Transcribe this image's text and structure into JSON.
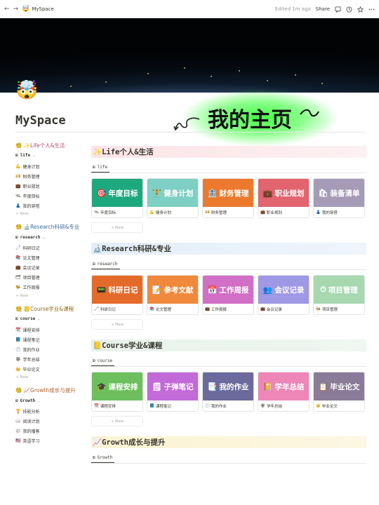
{
  "topbar": {
    "back": "←",
    "forward": "→",
    "page_icon": "🤯",
    "page_name": "MySpace",
    "edited": "Edited 1m ago",
    "share": "Share",
    "icons": [
      "comment-icon",
      "clock-icon",
      "star-icon",
      "more-icon"
    ]
  },
  "page": {
    "emoji": "🤯",
    "title": "MySpace"
  },
  "overlay": {
    "text": "我的主页"
  },
  "sidebar": [
    {
      "heading": "🧐 ✨Life个人&生活",
      "color": "pink",
      "view": "life",
      "items": [
        {
          "icon": "💪",
          "label": "健身计划"
        },
        {
          "icon": "💴",
          "label": "财务管理"
        },
        {
          "icon": "💼",
          "label": "职业规划"
        },
        {
          "icon": "🛰",
          "label": "年度目标"
        },
        {
          "icon": "👗",
          "label": "我的穿搭"
        }
      ],
      "new": "+ New"
    },
    {
      "heading": "🧐 🔬Research科研&专业",
      "color": "blue",
      "view": "research",
      "items": [
        {
          "icon": "🧷",
          "label": "科研日记"
        },
        {
          "icon": "📚",
          "label": "论文管理"
        },
        {
          "icon": "💼",
          "label": "会议记录"
        },
        {
          "icon": "🗂",
          "label": "项目管理"
        },
        {
          "icon": "🐝",
          "label": "工作周报"
        }
      ],
      "new": "+ New"
    },
    {
      "heading": "🧐 📒Course学业&课程",
      "color": "yellow",
      "view": "course",
      "items": [
        {
          "icon": "📆",
          "label": "课程安排"
        },
        {
          "icon": "📘",
          "label": "课程笔记"
        },
        {
          "icon": "🕚",
          "label": "我的作业"
        },
        {
          "icon": "🏵",
          "label": "学年总结"
        },
        {
          "icon": "👑",
          "label": "毕业论文"
        }
      ],
      "new": "+ New"
    },
    {
      "heading": "🧐 📈Growth成长与提升",
      "color": "orange",
      "view": "Growth",
      "items": [
        {
          "icon": "🏆",
          "label": "技能分析"
        },
        {
          "icon": "📖",
          "label": "阅读计划"
        },
        {
          "icon": "📰",
          "label": "我的播客"
        },
        {
          "icon": "🇺🇸",
          "label": "英语学习"
        }
      ],
      "new": ""
    }
  ],
  "sections": [
    {
      "title": "✨Life个人&生活",
      "color": "pink",
      "view": "life",
      "cards": [
        {
          "emoji": "🎯",
          "cover": "年度目标",
          "bg": "#1ea87e",
          "icon": "🛰",
          "title": "年度目标"
        },
        {
          "emoji": "🏋",
          "cover": "健身计划",
          "bg": "#7ecfc4",
          "icon": "💪",
          "title": "健身计划"
        },
        {
          "emoji": "🏦",
          "cover": "财务管理",
          "bg": "#ec7a2e",
          "icon": "💴",
          "title": "财务管理"
        },
        {
          "emoji": "💼",
          "cover": "职业规划",
          "bg": "#e1646e",
          "icon": "💼",
          "title": "职业规划"
        },
        {
          "emoji": "🛍",
          "cover": "装备清单",
          "bg": "#a69bb6",
          "icon": "👗",
          "title": "我的穿搭"
        }
      ],
      "new": "+ New"
    },
    {
      "title": "🔬Research科研&专业",
      "color": "blue",
      "view": "research",
      "cards": [
        {
          "emoji": "📟",
          "cover": "科研日记",
          "bg": "#e46a2a",
          "icon": "🧷",
          "title": "科研日记"
        },
        {
          "emoji": "📝",
          "cover": "参考文献",
          "bg": "#f0893b",
          "icon": "📚",
          "title": "论文管理"
        },
        {
          "emoji": "📅",
          "cover": "工作周报",
          "bg": "#d16ec6",
          "icon": "💼",
          "title": "工作周报"
        },
        {
          "emoji": "👥",
          "cover": "会议记录",
          "bg": "#9f98e4",
          "icon": "💼",
          "title": "会议记录"
        },
        {
          "emoji": "⏱",
          "cover": "项目管理",
          "bg": "#a7d8b0",
          "icon": "🐝",
          "title": "项目管理"
        }
      ],
      "new": "+ New"
    },
    {
      "title": "📒Course学业&课程",
      "color": "green",
      "view": "course",
      "cards": [
        {
          "emoji": "🎓",
          "cover": "课程安排",
          "bg": "#6cbf5c",
          "icon": "📆",
          "title": "课程安排"
        },
        {
          "emoji": "🗒",
          "cover": "子弹笔记",
          "bg": "#c36ad9",
          "icon": "📘",
          "title": "课程笔记"
        },
        {
          "emoji": "📑",
          "cover": "我的作业",
          "bg": "#6c6a9c",
          "icon": "🕚",
          "title": "我的作业"
        },
        {
          "emoji": "📔",
          "cover": "学年总结",
          "bg": "#ee86b8",
          "icon": "🏵",
          "title": "学年总结"
        },
        {
          "emoji": "📋",
          "cover": "毕业论文",
          "bg": "#8a7b98",
          "icon": "👑",
          "title": "毕业论文"
        }
      ],
      "new": "+ New"
    },
    {
      "title": "📈Growth成长与提升",
      "color": "yellow",
      "view": "Growth",
      "cards": [],
      "new": ""
    }
  ]
}
